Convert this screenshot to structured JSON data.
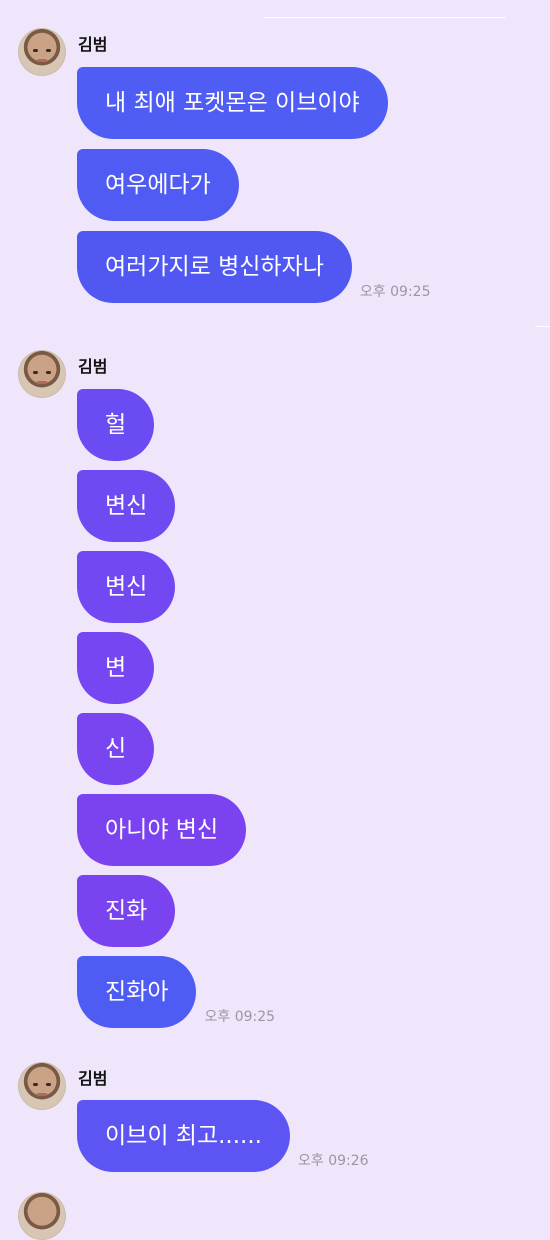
{
  "groups": [
    {
      "sender": "김범",
      "messages": [
        "내 최애 포켓몬은 이브이야",
        "여우에다가",
        "여러가지로 병신하자나"
      ],
      "time": "오후 09:25"
    },
    {
      "sender": "김범",
      "messages": [
        "헐",
        "변신",
        "변신",
        "변",
        "신",
        "아니야 변신",
        "진화",
        "진화아"
      ],
      "time": "오후 09:25"
    },
    {
      "sender": "김범",
      "messages": [
        "이브이 최고......"
      ],
      "time": "오후 09:26"
    }
  ],
  "colors": {
    "background": "#efe6fb",
    "bubble_blue": "#4f5cf4",
    "bubble_purple": "#7a43f0"
  }
}
